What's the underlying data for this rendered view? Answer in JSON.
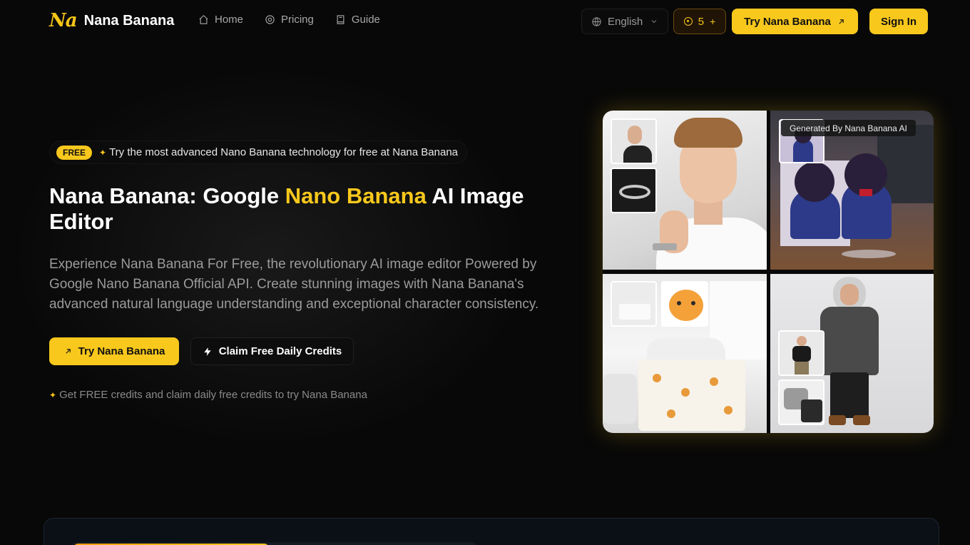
{
  "brand": {
    "logo_text": "Na",
    "name": "Nana Banana"
  },
  "nav": [
    {
      "label": "Home",
      "icon": "home-icon"
    },
    {
      "label": "Pricing",
      "icon": "pricing-icon"
    },
    {
      "label": "Guide",
      "icon": "book-icon"
    }
  ],
  "header": {
    "language": "English",
    "credits": "5",
    "credits_plus": "+",
    "try_label": "Try Nana Banana",
    "signin_label": "Sign In"
  },
  "hero": {
    "badge": "FREE",
    "badge_text": "Try the most advanced Nano Banana technology for free at Nana Banana",
    "title_part1": "Nana Banana: Google ",
    "title_highlight": "Nano Banana",
    "title_part2": " AI Image Editor",
    "description": "Experience Nana Banana For Free, the revolutionary AI image editor Powered by Google Nano Banana Official API. Create stunning images with Nana Banana's advanced natural language understanding and exceptional character consistency.",
    "try_label": "Try Nana Banana",
    "claim_label": "Claim Free Daily Credits",
    "note": "Get FREE credits and claim daily free credits to try Nana Banana"
  },
  "gallery": {
    "generated_label": "Generated By Nana Banana AI"
  },
  "colors": {
    "accent": "#f8c81c",
    "background": "#080808",
    "muted_text": "#9b9b9b"
  }
}
